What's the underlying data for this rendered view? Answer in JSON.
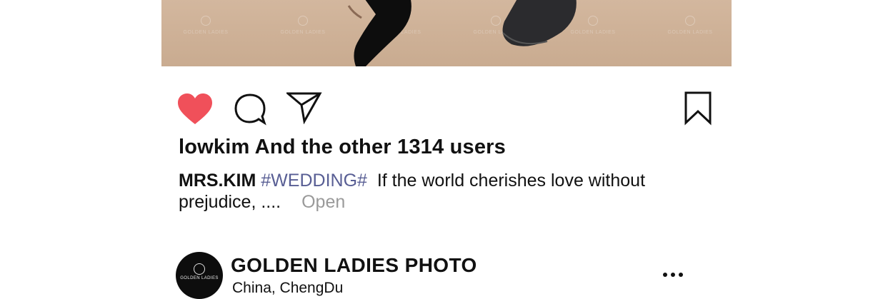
{
  "post": {
    "photo_watermark": "GOLDEN LADIES",
    "likes_text": "lowkim And the other 1314 users",
    "caption": {
      "user": "MRS.KIM",
      "hashtag": "#WEDDING#",
      "text": "If the world cherishes love without prejudice, ....",
      "more_label": "Open"
    }
  },
  "actions": {
    "like_icon": "heart-filled-icon",
    "comment_icon": "speech-bubble-icon",
    "share_icon": "paper-plane-icon",
    "save_icon": "bookmark-icon",
    "like_color": "#f0505a"
  },
  "profile": {
    "avatar_text": "GOLDEN LADIES",
    "account_name": "GOLDEN LADIES PHOTO",
    "location": "China, ChengDu",
    "more_icon": "more-dots-icon"
  }
}
